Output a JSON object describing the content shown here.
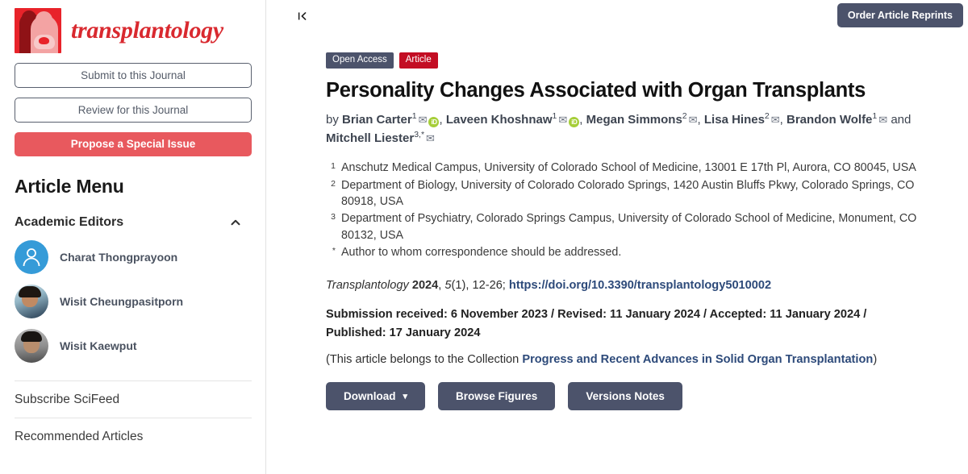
{
  "sidebar": {
    "brand": {
      "name": "transplantology",
      "logo_icon": "transplantology-logo"
    },
    "buttons": [
      {
        "label": "Submit to this Journal",
        "style": "outline"
      },
      {
        "label": "Review for this Journal",
        "style": "outline"
      },
      {
        "label": "Propose a Special Issue",
        "style": "solid-red"
      }
    ],
    "article_menu_title": "Article Menu",
    "academic_editors": {
      "label": "Academic Editors",
      "expanded": true,
      "chevron_icon": "chevron-up-icon",
      "editors": [
        {
          "name": "Charat Thongprayoon",
          "avatar": "placeholder-person-avatar"
        },
        {
          "name": "Wisit Cheungpasitporn",
          "avatar": "photo-avatar"
        },
        {
          "name": "Wisit Kaewput",
          "avatar": "photo-avatar"
        }
      ]
    },
    "menu_links": [
      {
        "label": "Subscribe SciFeed"
      },
      {
        "label": "Recommended Articles"
      }
    ]
  },
  "main": {
    "collapse_icon": "collapse-sidebar-icon",
    "reprints_button": "Order Article Reprints",
    "badges": [
      {
        "label": "Open Access",
        "color": "#4c536b"
      },
      {
        "label": "Article",
        "color": "#c30d23"
      }
    ],
    "title": "Personality Changes Associated with Organ Transplants",
    "authors": {
      "prefix": "by",
      "conjunction": "and",
      "list": [
        {
          "name": "Brian Carter",
          "affil": "1",
          "has_mail": true,
          "has_orcid": true,
          "separator": ","
        },
        {
          "name": "Laveen Khoshnaw",
          "affil": "1",
          "has_mail": true,
          "has_orcid": true,
          "separator": ","
        },
        {
          "name": "Megan Simmons",
          "affil": "2",
          "has_mail": true,
          "has_orcid": false,
          "separator": ","
        },
        {
          "name": "Lisa Hines",
          "affil": "2",
          "has_mail": true,
          "has_orcid": false,
          "separator": ","
        },
        {
          "name": "Brandon Wolfe",
          "affil": "1",
          "has_mail": true,
          "has_orcid": false,
          "separator": ""
        },
        {
          "name": "Mitchell Liester",
          "affil": "3,*",
          "has_mail": true,
          "has_orcid": false,
          "separator": ""
        }
      ],
      "mail_icon": "envelope-icon",
      "orcid_icon": "orcid-icon",
      "orcid_label": "iD"
    },
    "affiliations": [
      {
        "mark": "1",
        "text": "Anschutz Medical Campus, University of Colorado School of Medicine, 13001 E 17th Pl, Aurora, CO 80045, USA"
      },
      {
        "mark": "2",
        "text": "Department of Biology, University of Colorado Colorado Springs, 1420 Austin Bluffs Pkwy, Colorado Springs, CO 80918, USA"
      },
      {
        "mark": "3",
        "text": "Department of Psychiatry, Colorado Springs Campus, University of Colorado School of Medicine, Monument, CO 80132, USA"
      },
      {
        "mark": "*",
        "text": "Author to whom correspondence should be addressed."
      }
    ],
    "citation": {
      "journal": "Transplantology",
      "year": "2024",
      "volume": "5",
      "issue": "(1)",
      "pages": ", 12-26; ",
      "comma": ", ",
      "semicolon": ";",
      "doi_text": "https://doi.org/10.3390/transplantology5010002"
    },
    "dates": "Submission received: 6 November 2023 / Revised: 11 January 2024 / Accepted: 11 January 2024 / Published: 17 January 2024",
    "collection": {
      "prefix": "(This article belongs to the Collection ",
      "link": "Progress and Recent Advances in Solid Organ Transplantation",
      "suffix": ")"
    },
    "actions": [
      {
        "label": "Download",
        "has_caret": true,
        "caret_icon": "chevron-down-icon"
      },
      {
        "label": "Browse Figures",
        "has_caret": false
      },
      {
        "label": "Versions Notes",
        "has_caret": false
      }
    ]
  },
  "colors": {
    "brand_red": "#d9292f",
    "slate": "#4c536b",
    "crimson": "#c30d23",
    "link_blue": "#2d4a7a",
    "orcid_green": "#a6ce39"
  }
}
